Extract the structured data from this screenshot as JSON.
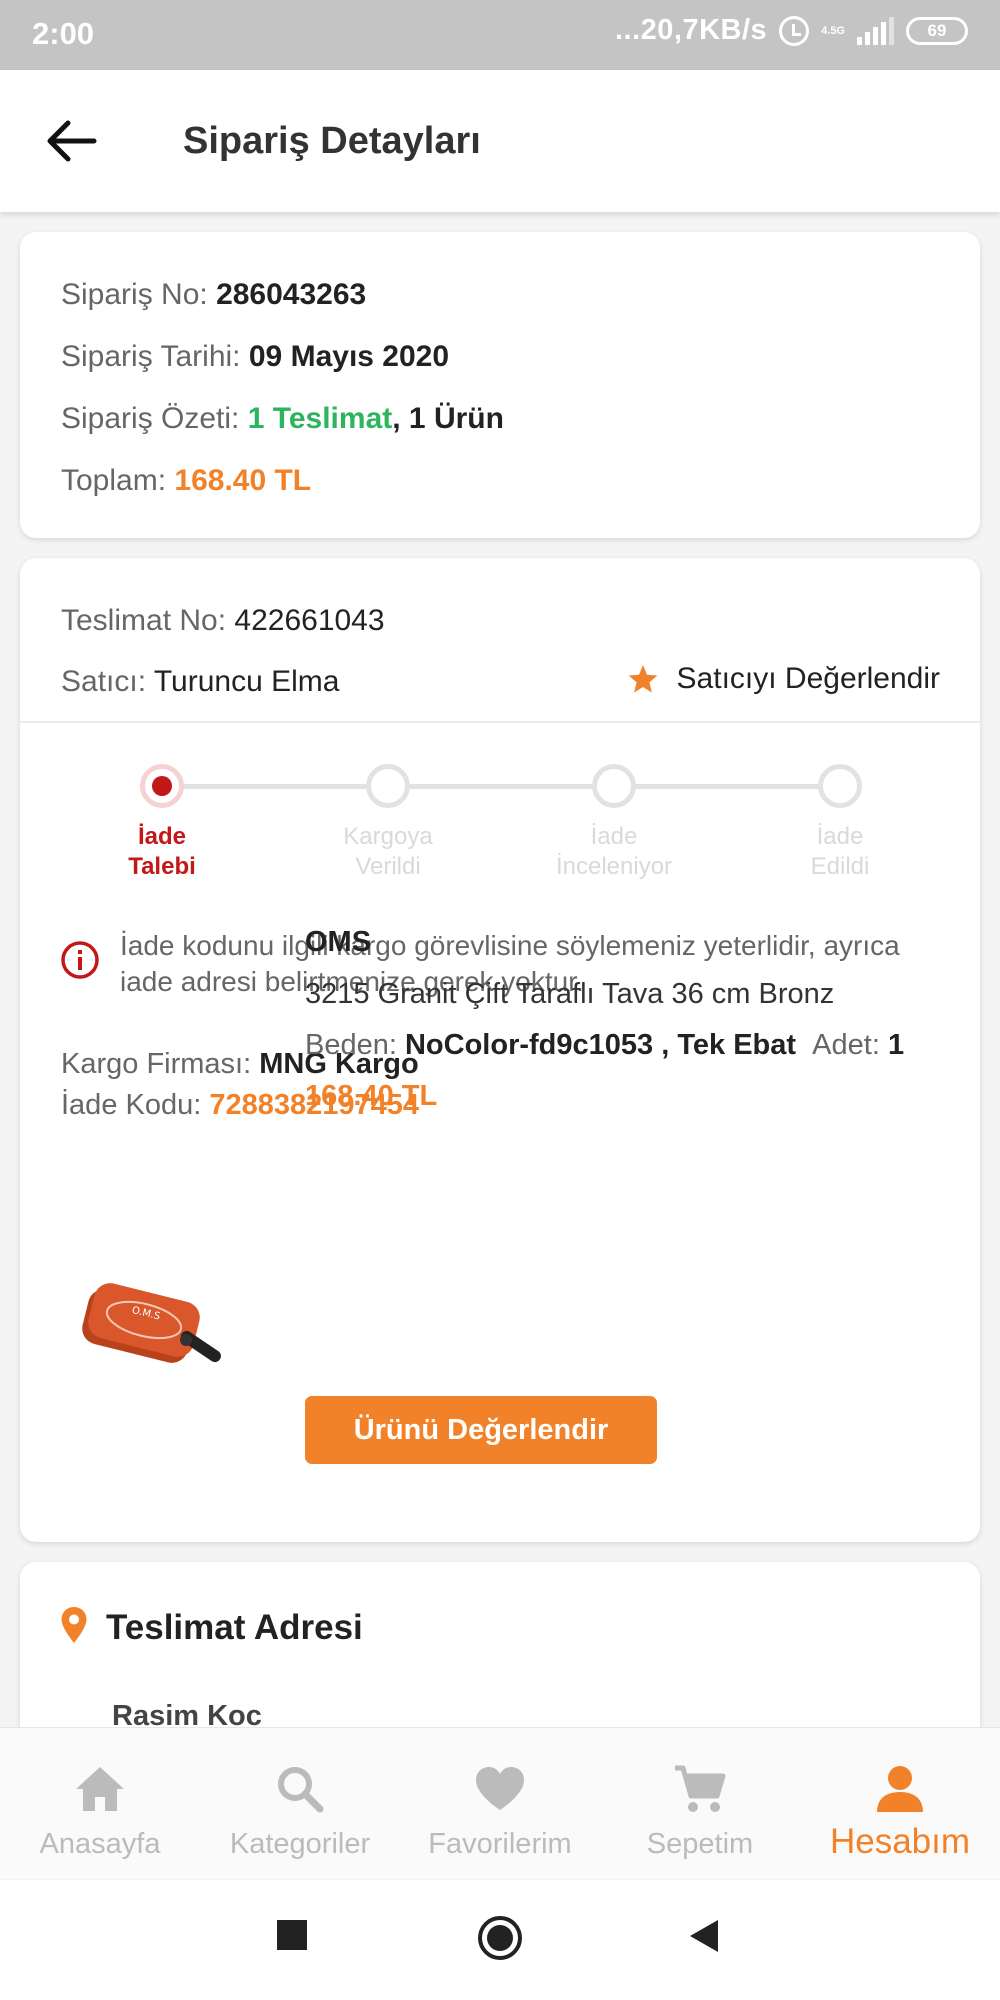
{
  "status_bar": {
    "time": "2:00",
    "speed": "...20,7KB/s",
    "network": "4.5G",
    "battery": "69"
  },
  "header": {
    "title": "Sipariş Detayları"
  },
  "order_summary": {
    "order_no_label": "Sipariş No:",
    "order_no": "286043263",
    "order_date_label": "Sipariş Tarihi:",
    "order_date": "09 Mayıs 2020",
    "order_summary_label": "Sipariş Özeti:",
    "delivery_count": "1 Teslimat",
    "product_count": ", 1 Ürün",
    "total_label": "Toplam:",
    "total": "168.40 TL"
  },
  "delivery": {
    "delivery_no_label": "Teslimat No:",
    "delivery_no": "422661043",
    "seller_label": "Satıcı:",
    "seller": "Turuncu Elma",
    "rate_seller": "Satıcıyı Değerlendir",
    "steps": [
      {
        "line1": "İade",
        "line2": "Talebi",
        "active": true
      },
      {
        "line1": "Kargoya",
        "line2": "Verildi",
        "active": false
      },
      {
        "line1": "İade",
        "line2": "İnceleniyor",
        "active": false
      },
      {
        "line1": "İade",
        "line2": "Edildi",
        "active": false
      }
    ],
    "alert_text": "İade kodunu ilgili kargo görevlisine söylemeniz yeterlidir, ayrıca iade adresi belirtmenize gerek yoktur.",
    "cargo_company_label": "Kargo Firması:",
    "cargo_company": "MNG Kargo",
    "return_code_label": "İade Kodu:",
    "return_code": "7288382197454",
    "product": {
      "brand": "OMS",
      "name": "3215 Granit Çift Taraflı Tava 36 cm Bronz",
      "size_label": "Beden:",
      "size": "NoColor-fd9c1053 , Tek Ebat",
      "qty_label": "Adet:",
      "qty": "1",
      "price": "168.40 TL",
      "rate_button": "Ürünü Değerlendir"
    }
  },
  "address": {
    "title": "Teslimat Adresi",
    "name": "Rasim  Koc"
  },
  "bottom_nav": {
    "items": [
      {
        "label": "Anasayfa",
        "icon": "home-icon"
      },
      {
        "label": "Kategoriler",
        "icon": "search-icon"
      },
      {
        "label": "Favorilerim",
        "icon": "heart-icon"
      },
      {
        "label": "Sepetim",
        "icon": "cart-icon"
      },
      {
        "label": "Hesabım",
        "icon": "user-icon"
      }
    ],
    "active_index": 4
  },
  "colors": {
    "accent": "#f28229",
    "green": "#2eb35f",
    "red": "#c41717"
  }
}
